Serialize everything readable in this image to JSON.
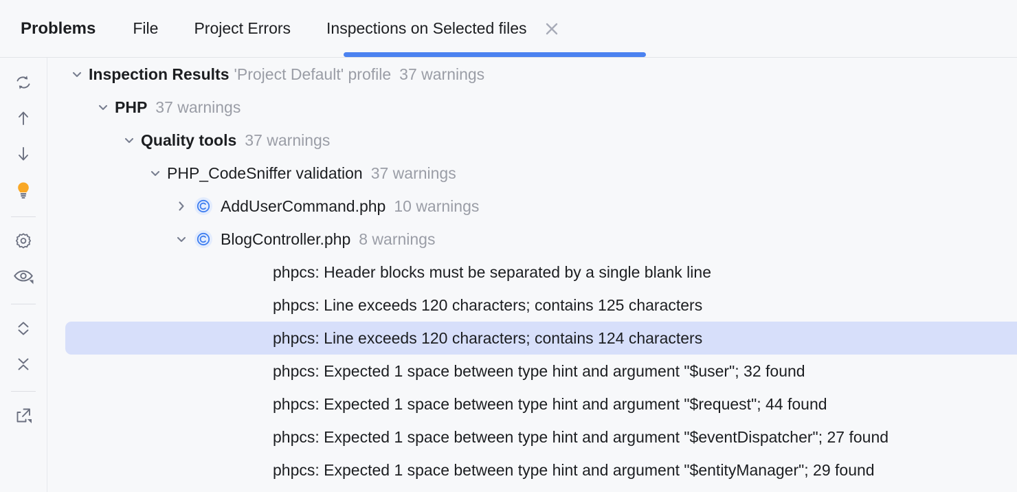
{
  "window": {
    "title": "Problems"
  },
  "tabs": [
    {
      "label": "File",
      "active": false
    },
    {
      "label": "Project Errors",
      "active": false
    },
    {
      "label": "Inspections on Selected files",
      "active": true
    }
  ],
  "tab_close": {
    "icon": "close-icon",
    "label": "×"
  },
  "toolbar": {
    "items": [
      {
        "name": "rerun-icon",
        "tooltip": "Rerun inspection"
      },
      {
        "name": "previous-problem-icon",
        "tooltip": "Previous Problem"
      },
      {
        "name": "next-problem-icon",
        "tooltip": "Next Problem"
      },
      {
        "name": "lightbulb-icon",
        "tooltip": "Show Quick Fixes"
      },
      {
        "name": "settings-gear-icon",
        "tooltip": "Edit Settings"
      },
      {
        "name": "eye-preview-icon",
        "tooltip": "View Options"
      },
      {
        "name": "expand-all-icon",
        "tooltip": "Expand All"
      },
      {
        "name": "collapse-all-icon",
        "tooltip": "Collapse All"
      },
      {
        "name": "export-icon",
        "tooltip": "Export"
      }
    ]
  },
  "tree": {
    "root": {
      "label": "Inspection Results",
      "profile": "'Project Default' profile",
      "count": "37 warnings",
      "expanded": true
    },
    "php": {
      "label": "PHP",
      "count": "37 warnings",
      "expanded": true
    },
    "quality_tools": {
      "label": "Quality tools",
      "count": "37 warnings",
      "expanded": true
    },
    "inspection": {
      "label": "PHP_CodeSniffer validation",
      "count": "37 warnings",
      "expanded": true
    },
    "files": [
      {
        "name": "AddUserCommand.php",
        "count": "10 warnings",
        "expanded": false,
        "icon": "php-class-icon"
      },
      {
        "name": "BlogController.php",
        "count": "8 warnings",
        "expanded": true,
        "icon": "php-class-icon"
      }
    ],
    "problems": [
      {
        "text": "phpcs: Header blocks must be separated by a single blank line",
        "selected": false
      },
      {
        "text": "phpcs: Line exceeds 120 characters; contains 125 characters",
        "selected": false
      },
      {
        "text": "phpcs: Line exceeds 120 characters; contains 124 characters",
        "selected": true
      },
      {
        "text": "phpcs: Expected 1 space between type hint and argument \"$user\"; 32 found",
        "selected": false
      },
      {
        "text": "phpcs: Expected 1 space between type hint and argument \"$request\"; 44 found",
        "selected": false
      },
      {
        "text": "phpcs: Expected 1 space between type hint and argument \"$eventDispatcher\"; 27 found",
        "selected": false
      },
      {
        "text": "phpcs: Expected 1 space between type hint and argument \"$entityManager\"; 29 found",
        "selected": false
      }
    ]
  },
  "colors": {
    "accent_blue": "#4b82f0",
    "selection_bg": "#d7dffa",
    "muted_text": "#9a9da6",
    "background": "#f7f8fa",
    "lightbulb_amber": "#f9a826",
    "icon_grey": "#6b7080"
  }
}
